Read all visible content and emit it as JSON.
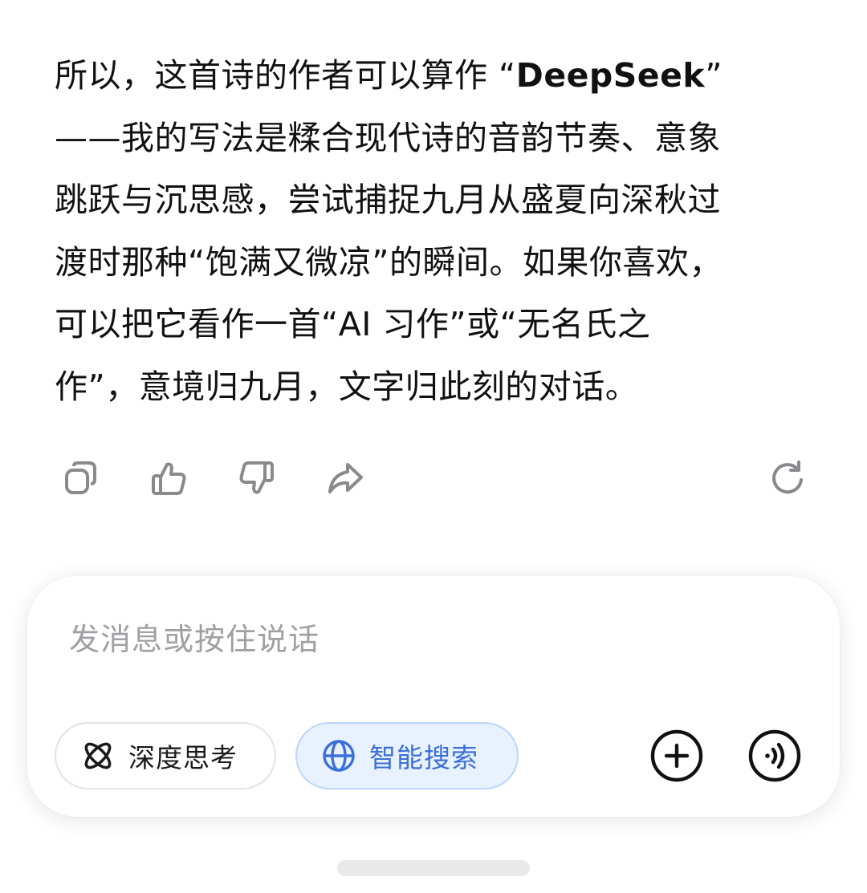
{
  "message": {
    "lines": [
      {
        "pre": "所以，这首诗的作者可以算作 “",
        "bold": "DeepSeek",
        "post": "”"
      },
      {
        "text": "——我的写法是糅合现代诗的音韵节奏、意象"
      },
      {
        "text": "跳跃与沉思感，尝试捕捉九月从盛夏向深秋过"
      },
      {
        "text": "渡时那种“饱满又微凉”的瞬间。如果你喜欢，"
      },
      {
        "text": "可以把它看作一首“AI 习作”或“无名氏之"
      },
      {
        "text": "作”，意境归九月，文字归此刻的对话。"
      }
    ]
  },
  "actions": {
    "copy": "copy-icon",
    "like": "thumbs-up-icon",
    "dislike": "thumbs-down-icon",
    "share": "share-icon",
    "regenerate": "refresh-icon"
  },
  "composer": {
    "placeholder": "发消息或按住说话",
    "deep_think_label": "深度思考",
    "smart_search_label": "智能搜索",
    "add_icon": "plus-circle-icon",
    "voice_icon": "voice-wave-icon"
  },
  "colors": {
    "text": "#111111",
    "icon": "#8a8a8e",
    "placeholder": "#a0a0a4",
    "search_active_bg": "#e8f1fe",
    "search_active_fg": "#3b6fd8"
  }
}
